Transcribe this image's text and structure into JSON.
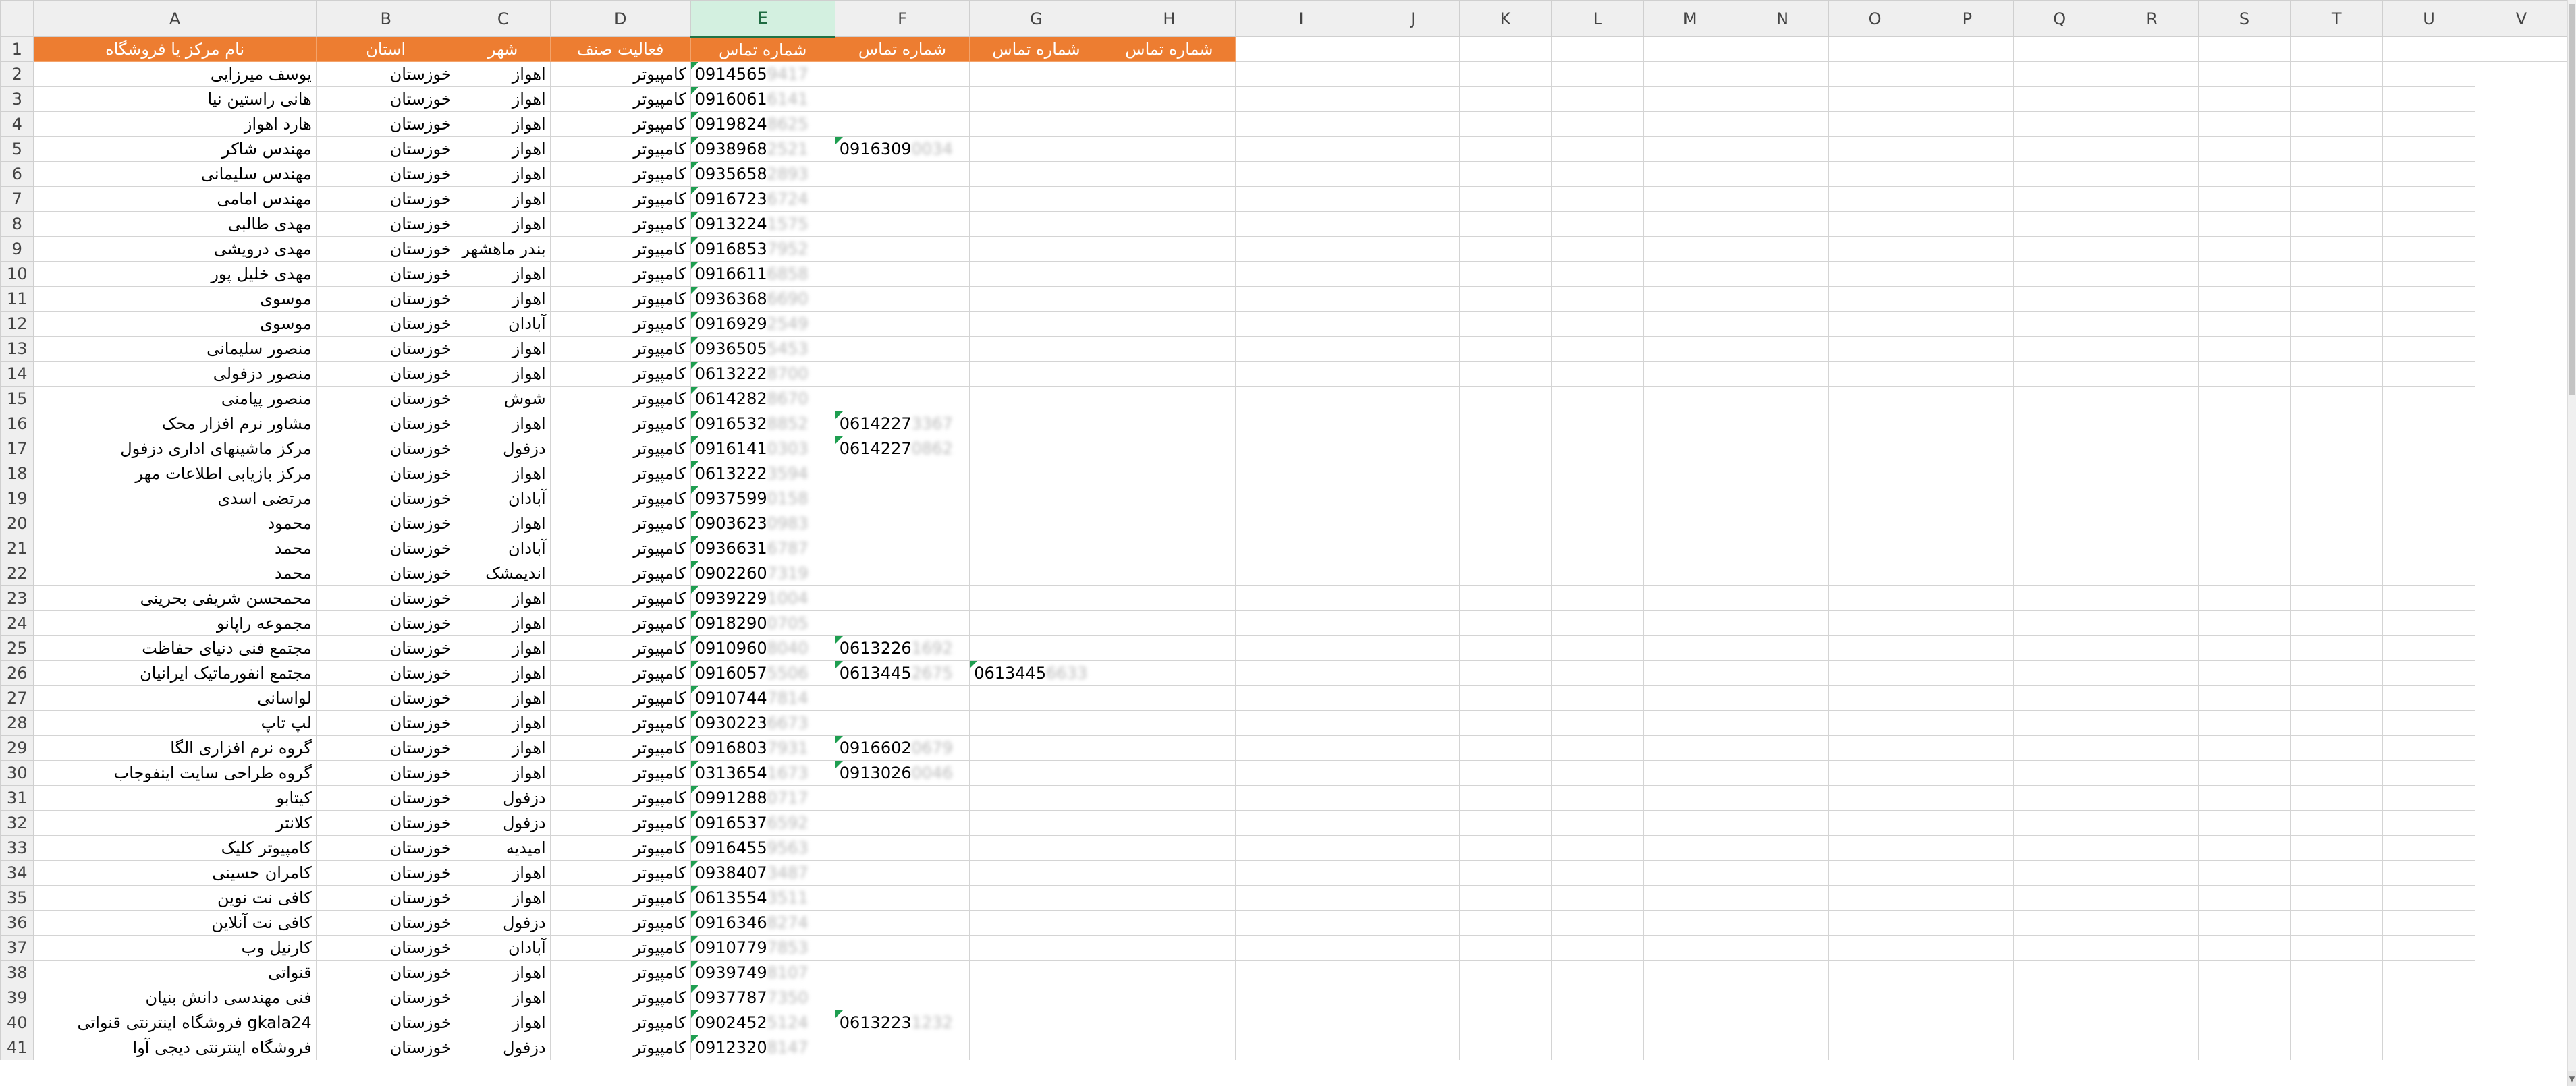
{
  "columns": [
    "A",
    "B",
    "C",
    "D",
    "E",
    "F",
    "G",
    "H",
    "I",
    "J",
    "K",
    "L",
    "M",
    "N",
    "O",
    "P",
    "Q",
    "R",
    "S",
    "T",
    "U",
    "V"
  ],
  "selected_column": "E",
  "header_row": {
    "row_number": "1",
    "cells": [
      "نام مرکز یا فروشگاه",
      "استان",
      "شهر",
      "فعالیت صنف",
      "شماره تماس",
      "شماره تماس",
      "شماره تماس",
      "شماره تماس"
    ]
  },
  "rows": [
    {
      "n": "2",
      "name": "یوسف میرزایی",
      "province": "خوزستان",
      "city": "اهواز",
      "activity": "کامپیوتر",
      "e": "0914565",
      "e_hidden": "9417",
      "f": "",
      "f_hidden": "",
      "g": "",
      "g_hidden": ""
    },
    {
      "n": "3",
      "name": "هانی راستین نیا",
      "province": "خوزستان",
      "city": "اهواز",
      "activity": "کامپیوتر",
      "e": "0916061",
      "e_hidden": "6141",
      "f": "",
      "f_hidden": "",
      "g": "",
      "g_hidden": ""
    },
    {
      "n": "4",
      "name": "هارد اهواز",
      "province": "خوزستان",
      "city": "اهواز",
      "activity": "کامپیوتر",
      "e": "0919824",
      "e_hidden": "8625",
      "f": "",
      "f_hidden": "",
      "g": "",
      "g_hidden": ""
    },
    {
      "n": "5",
      "name": "مهندس شاکر",
      "province": "خوزستان",
      "city": "اهواز",
      "activity": "کامپیوتر",
      "e": "0938968",
      "e_hidden": "2521",
      "f": "0916309",
      "f_hidden": "0034",
      "g": "",
      "g_hidden": ""
    },
    {
      "n": "6",
      "name": "مهندس سلیمانی",
      "province": "خوزستان",
      "city": "اهواز",
      "activity": "کامپیوتر",
      "e": "0935658",
      "e_hidden": "2893",
      "f": "",
      "f_hidden": "",
      "g": "",
      "g_hidden": ""
    },
    {
      "n": "7",
      "name": "مهندس امامی",
      "province": "خوزستان",
      "city": "اهواز",
      "activity": "کامپیوتر",
      "e": "0916723",
      "e_hidden": "6724",
      "f": "",
      "f_hidden": "",
      "g": "",
      "g_hidden": ""
    },
    {
      "n": "8",
      "name": "مهدی طالبی",
      "province": "خوزستان",
      "city": "اهواز",
      "activity": "کامپیوتر",
      "e": "0913224",
      "e_hidden": "1575",
      "f": "",
      "f_hidden": "",
      "g": "",
      "g_hidden": ""
    },
    {
      "n": "9",
      "name": "مهدی درویشی",
      "province": "خوزستان",
      "city": "بندر ماهشهر",
      "activity": "کامپیوتر",
      "e": "0916853",
      "e_hidden": "7952",
      "f": "",
      "f_hidden": "",
      "g": "",
      "g_hidden": ""
    },
    {
      "n": "10",
      "name": "مهدی خلیل پور",
      "province": "خوزستان",
      "city": "اهواز",
      "activity": "کامپیوتر",
      "e": "0916611",
      "e_hidden": "6858",
      "f": "",
      "f_hidden": "",
      "g": "",
      "g_hidden": ""
    },
    {
      "n": "11",
      "name": "موسوی",
      "province": "خوزستان",
      "city": "اهواز",
      "activity": "کامپیوتر",
      "e": "0936368",
      "e_hidden": "6690",
      "f": "",
      "f_hidden": "",
      "g": "",
      "g_hidden": ""
    },
    {
      "n": "12",
      "name": "موسوی",
      "province": "خوزستان",
      "city": "آبادان",
      "activity": "کامپیوتر",
      "e": "0916929",
      "e_hidden": "2549",
      "f": "",
      "f_hidden": "",
      "g": "",
      "g_hidden": ""
    },
    {
      "n": "13",
      "name": "منصور سلیمانی",
      "province": "خوزستان",
      "city": "اهواز",
      "activity": "کامپیوتر",
      "e": "0936505",
      "e_hidden": "5453",
      "f": "",
      "f_hidden": "",
      "g": "",
      "g_hidden": ""
    },
    {
      "n": "14",
      "name": "منصور دزفولی",
      "province": "خوزستان",
      "city": "اهواز",
      "activity": "کامپیوتر",
      "e": "0613222",
      "e_hidden": "8700",
      "f": "",
      "f_hidden": "",
      "g": "",
      "g_hidden": ""
    },
    {
      "n": "15",
      "name": "منصور پیامنی",
      "province": "خوزستان",
      "city": "شوش",
      "activity": "کامپیوتر",
      "e": "0614282",
      "e_hidden": "8670",
      "f": "",
      "f_hidden": "",
      "g": "",
      "g_hidden": ""
    },
    {
      "n": "16",
      "name": "مشاور نرم افزار محک",
      "province": "خوزستان",
      "city": "اهواز",
      "activity": "کامپیوتر",
      "e": "0916532",
      "e_hidden": "8852",
      "f": "0614227",
      "f_hidden": "3367",
      "g": "",
      "g_hidden": ""
    },
    {
      "n": "17",
      "name": "مرکز ماشینهای اداری دزفول",
      "province": "خوزستان",
      "city": "دزفول",
      "activity": "کامپیوتر",
      "e": "0916141",
      "e_hidden": "0303",
      "f": "0614227",
      "f_hidden": "0862",
      "g": "",
      "g_hidden": ""
    },
    {
      "n": "18",
      "name": "مرکز بازیابی اطلاعات مهر",
      "province": "خوزستان",
      "city": "اهواز",
      "activity": "کامپیوتر",
      "e": "0613222",
      "e_hidden": "3594",
      "f": "",
      "f_hidden": "",
      "g": "",
      "g_hidden": ""
    },
    {
      "n": "19",
      "name": "مرتضی اسدی",
      "province": "خوزستان",
      "city": "آبادان",
      "activity": "کامپیوتر",
      "e": "0937599",
      "e_hidden": "0158",
      "f": "",
      "f_hidden": "",
      "g": "",
      "g_hidden": ""
    },
    {
      "n": "20",
      "name": "محمود",
      "province": "خوزستان",
      "city": "اهواز",
      "activity": "کامپیوتر",
      "e": "0903623",
      "e_hidden": "0983",
      "f": "",
      "f_hidden": "",
      "g": "",
      "g_hidden": ""
    },
    {
      "n": "21",
      "name": "محمد",
      "province": "خوزستان",
      "city": "آبادان",
      "activity": "کامپیوتر",
      "e": "0936631",
      "e_hidden": "6787",
      "f": "",
      "f_hidden": "",
      "g": "",
      "g_hidden": ""
    },
    {
      "n": "22",
      "name": "محمد",
      "province": "خوزستان",
      "city": "اندیمشک",
      "activity": "کامپیوتر",
      "e": "0902260",
      "e_hidden": "7319",
      "f": "",
      "f_hidden": "",
      "g": "",
      "g_hidden": ""
    },
    {
      "n": "23",
      "name": "محمحسن شریفی بحرینی",
      "province": "خوزستان",
      "city": "اهواز",
      "activity": "کامپیوتر",
      "e": "0939229",
      "e_hidden": "1004",
      "f": "",
      "f_hidden": "",
      "g": "",
      "g_hidden": ""
    },
    {
      "n": "24",
      "name": "مجموعه راپانو",
      "province": "خوزستان",
      "city": "اهواز",
      "activity": "کامپیوتر",
      "e": "0918290",
      "e_hidden": "0705",
      "f": "",
      "f_hidden": "",
      "g": "",
      "g_hidden": ""
    },
    {
      "n": "25",
      "name": "مجتمع فنی دنیای حفاظت",
      "province": "خوزستان",
      "city": "اهواز",
      "activity": "کامپیوتر",
      "e": "0910960",
      "e_hidden": "8040",
      "f": "0613226",
      "f_hidden": "1692",
      "g": "",
      "g_hidden": ""
    },
    {
      "n": "26",
      "name": "مجتمع انفورماتیک ایرانیان",
      "province": "خوزستان",
      "city": "اهواز",
      "activity": "کامپیوتر",
      "e": "0916057",
      "e_hidden": "5506",
      "f": "0613445",
      "f_hidden": "2675",
      "g": "0613445",
      "g_hidden": "6633"
    },
    {
      "n": "27",
      "name": "لواسانی",
      "province": "خوزستان",
      "city": "اهواز",
      "activity": "کامپیوتر",
      "e": "0910744",
      "e_hidden": "7814",
      "f": "",
      "f_hidden": "",
      "g": "",
      "g_hidden": ""
    },
    {
      "n": "28",
      "name": "لپ تاپ",
      "province": "خوزستان",
      "city": "اهواز",
      "activity": "کامپیوتر",
      "e": "0930223",
      "e_hidden": "6673",
      "f": "",
      "f_hidden": "",
      "g": "",
      "g_hidden": ""
    },
    {
      "n": "29",
      "name": "گروه نرم افزاری الگا",
      "province": "خوزستان",
      "city": "اهواز",
      "activity": "کامپیوتر",
      "e": "0916803",
      "e_hidden": "7931",
      "f": "0916602",
      "f_hidden": "0679",
      "g": "",
      "g_hidden": ""
    },
    {
      "n": "30",
      "name": "گروه طراحی سایت اینفوجاب",
      "province": "خوزستان",
      "city": "اهواز",
      "activity": "کامپیوتر",
      "e": "0313654",
      "e_hidden": "1673",
      "f": "0913026",
      "f_hidden": "0046",
      "g": "",
      "g_hidden": ""
    },
    {
      "n": "31",
      "name": "کیتابو",
      "province": "خوزستان",
      "city": "دزفول",
      "activity": "کامپیوتر",
      "e": "0991288",
      "e_hidden": "0717",
      "f": "",
      "f_hidden": "",
      "g": "",
      "g_hidden": ""
    },
    {
      "n": "32",
      "name": "کلانتر",
      "province": "خوزستان",
      "city": "دزفول",
      "activity": "کامپیوتر",
      "e": "0916537",
      "e_hidden": "6592",
      "f": "",
      "f_hidden": "",
      "g": "",
      "g_hidden": ""
    },
    {
      "n": "33",
      "name": "کامپیوتر کلیک",
      "province": "خوزستان",
      "city": "امیدیه",
      "activity": "کامپیوتر",
      "e": "0916455",
      "e_hidden": "9563",
      "f": "",
      "f_hidden": "",
      "g": "",
      "g_hidden": ""
    },
    {
      "n": "34",
      "name": "کامران حسینی",
      "province": "خوزستان",
      "city": "اهواز",
      "activity": "کامپیوتر",
      "e": "0938407",
      "e_hidden": "3487",
      "f": "",
      "f_hidden": "",
      "g": "",
      "g_hidden": ""
    },
    {
      "n": "35",
      "name": "کافی نت نوین",
      "province": "خوزستان",
      "city": "اهواز",
      "activity": "کامپیوتر",
      "e": "0613554",
      "e_hidden": "3511",
      "f": "",
      "f_hidden": "",
      "g": "",
      "g_hidden": ""
    },
    {
      "n": "36",
      "name": "کافی نت آنلاین",
      "province": "خوزستان",
      "city": "دزفول",
      "activity": "کامپیوتر",
      "e": "0916346",
      "e_hidden": "8274",
      "f": "",
      "f_hidden": "",
      "g": "",
      "g_hidden": ""
    },
    {
      "n": "37",
      "name": "کارنیل وب",
      "province": "خوزستان",
      "city": "آبادان",
      "activity": "کامپیوتر",
      "e": "0910779",
      "e_hidden": "7853",
      "f": "",
      "f_hidden": "",
      "g": "",
      "g_hidden": ""
    },
    {
      "n": "38",
      "name": "قنواتی",
      "province": "خوزستان",
      "city": "اهواز",
      "activity": "کامپیوتر",
      "e": "0939749",
      "e_hidden": "8107",
      "f": "",
      "f_hidden": "",
      "g": "",
      "g_hidden": ""
    },
    {
      "n": "39",
      "name": "فنی مهندسی دانش بنیان",
      "province": "خوزستان",
      "city": "اهواز",
      "activity": "کامپیوتر",
      "e": "0937787",
      "e_hidden": "7350",
      "f": "",
      "f_hidden": "",
      "g": "",
      "g_hidden": ""
    },
    {
      "n": "40",
      "name": "فروشگاه اینترنتی قنواتی gkala24",
      "province": "خوزستان",
      "city": "اهواز",
      "activity": "کامپیوتر",
      "e": "0902452",
      "e_hidden": "5124",
      "f": "0613223",
      "f_hidden": "1232",
      "g": "",
      "g_hidden": ""
    },
    {
      "n": "41",
      "name": "فروشگاه اینترنتی دیجی آوا",
      "province": "خوزستان",
      "city": "دزفول",
      "activity": "کامپیوتر",
      "e": "0912320",
      "e_hidden": "8147",
      "f": "",
      "f_hidden": "",
      "g": "",
      "g_hidden": ""
    }
  ],
  "icons": {
    "flag": "green-triangle-error-indicator",
    "scroll": "scroll-down-arrow-icon"
  },
  "colors": {
    "header_fill": "#ed7d31",
    "header_text": "#ffffff",
    "flag": "#1e9e50",
    "selected_col": "#217346"
  }
}
